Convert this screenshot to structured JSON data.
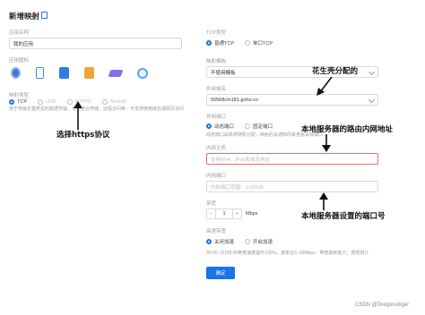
{
  "header": {
    "title": "新增映射"
  },
  "left": {
    "app_name_label": "应用名称",
    "app_name_value": "我的应用",
    "app_icon_label": "应用图标",
    "app_icons": [
      "blue-globe-icon",
      "phone-icon",
      "blue-file-icon",
      "orange-doc-icon",
      "purple-server-icon",
      "blue-dot-icon"
    ],
    "mapping_type_label": "映射类型",
    "types": [
      {
        "label": "TCP",
        "selected": true,
        "disabled": false
      },
      {
        "label": "UDP",
        "selected": false,
        "disabled": true
      },
      {
        "label": "HTTPS",
        "selected": false,
        "disabled": true
      },
      {
        "label": "Socks5",
        "selected": false,
        "disabled": true
      }
    ],
    "type_note": "用于传输长整类型的数据传输，也不适合传输，远程访问等，不支持使用域名或网页访问"
  },
  "right": {
    "tcp_type_label": "TCP类型",
    "tcp_types": [
      {
        "label": "普通TCP",
        "selected": true
      },
      {
        "label": "单口TCP",
        "selected": false
      }
    ],
    "mapping_template_label": "映射模板",
    "mapping_template_value": "不使用模板",
    "domain_label": "外网域名",
    "domain_value": "50568cm181.goho.co",
    "port_label": "外网端口",
    "port_options": [
      {
        "label": "动态端口",
        "selected": true
      },
      {
        "label": "固定端口",
        "selected": false
      }
    ],
    "port_note": "动态端口由系统随机分配，映射后会通知你来查看具体端口",
    "intranet_host_label": "内网主机",
    "intranet_host_placeholder": "支持IPv4、IPv6和域名地址",
    "intranet_port_label": "内网端口",
    "intranet_port_placeholder": "内网端口范围：1-65535",
    "bandwidth_label": "带宽",
    "bandwidth_value": "1",
    "bandwidth_unit": "Mbps",
    "accel_label": "高速带宽",
    "accel_options": [
      {
        "label": "关闭加速",
        "selected": true
      },
      {
        "label": "开启加速",
        "selected": false
      }
    ],
    "accel_note": "20:00~次日8:00带宽速度提升100%，速率在5~10Mbps：带宽最新能力，按规则计",
    "confirm_label": "确定"
  },
  "annotations": {
    "https": "选择https协议",
    "domain": "花生壳分配的",
    "host": "本地服务器的路由内网地址",
    "port": "本地服务器设置的端口号"
  },
  "watermark": "CSDN @DregonAtiger"
}
